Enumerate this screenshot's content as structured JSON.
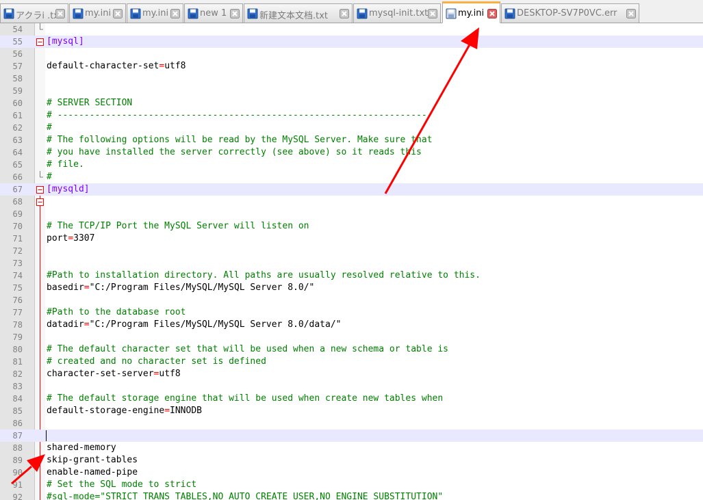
{
  "tabs": [
    {
      "label": "アクラi .txt",
      "icon": "saved-file-icon",
      "active": false
    },
    {
      "label": "my.ini",
      "icon": "saved-file-icon",
      "active": false
    },
    {
      "label": "my.ini",
      "icon": "saved-file-icon",
      "active": false
    },
    {
      "label": "new 1",
      "icon": "saved-file-icon",
      "active": false
    },
    {
      "label": "新建文本文档.txt",
      "icon": "saved-file-icon",
      "active": false
    },
    {
      "label": "mysql-init.txt",
      "icon": "saved-file-icon",
      "active": false
    },
    {
      "label": "my.ini",
      "icon": "unsaved-file-icon",
      "active": true
    },
    {
      "label": "DESKTOP-SV7P0VC.err",
      "icon": "saved-file-icon",
      "active": false
    }
  ],
  "editor": {
    "highlighted_lines": [
      55,
      67,
      87
    ],
    "caret_line": 87,
    "lines": [
      {
        "n": "54",
        "type": "empty",
        "text": ""
      },
      {
        "n": "55",
        "type": "section",
        "text": "[mysql]"
      },
      {
        "n": "56",
        "type": "empty",
        "text": ""
      },
      {
        "n": "57",
        "type": "kv",
        "key": "default-character-set",
        "op": "=",
        "val": "utf8"
      },
      {
        "n": "58",
        "type": "empty",
        "text": ""
      },
      {
        "n": "59",
        "type": "empty",
        "text": ""
      },
      {
        "n": "60",
        "type": "comment",
        "text": "# SERVER SECTION"
      },
      {
        "n": "61",
        "type": "comment",
        "text": "# ----------------------------------------------------------------------"
      },
      {
        "n": "62",
        "type": "comment",
        "text": "#"
      },
      {
        "n": "63",
        "type": "comment",
        "text": "# The following options will be read by the MySQL Server. Make sure that"
      },
      {
        "n": "64",
        "type": "comment",
        "text": "# you have installed the server correctly (see above) so it reads this"
      },
      {
        "n": "65",
        "type": "comment",
        "text": "# file."
      },
      {
        "n": "66",
        "type": "comment",
        "text": "#"
      },
      {
        "n": "67",
        "type": "section",
        "text": "[mysqld]"
      },
      {
        "n": "68",
        "type": "empty",
        "text": ""
      },
      {
        "n": "69",
        "type": "empty",
        "text": ""
      },
      {
        "n": "70",
        "type": "comment",
        "text": "# The TCP/IP Port the MySQL Server will listen on"
      },
      {
        "n": "71",
        "type": "kv",
        "key": "port",
        "op": "=",
        "val": "3307"
      },
      {
        "n": "72",
        "type": "empty",
        "text": ""
      },
      {
        "n": "73",
        "type": "empty",
        "text": ""
      },
      {
        "n": "74",
        "type": "comment",
        "text": "#Path to installation directory. All paths are usually resolved relative to this."
      },
      {
        "n": "75",
        "type": "kv",
        "key": "basedir",
        "op": "=",
        "val": "\"C:/Program Files/MySQL/MySQL Server 8.0/\""
      },
      {
        "n": "76",
        "type": "empty",
        "text": ""
      },
      {
        "n": "77",
        "type": "comment",
        "text": "#Path to the database root"
      },
      {
        "n": "78",
        "type": "kv",
        "key": "datadir",
        "op": "=",
        "val": "\"C:/Program Files/MySQL/MySQL Server 8.0/data/\""
      },
      {
        "n": "79",
        "type": "empty",
        "text": ""
      },
      {
        "n": "80",
        "type": "comment",
        "text": "# The default character set that will be used when a new schema or table is"
      },
      {
        "n": "81",
        "type": "comment",
        "text": "# created and no character set is defined"
      },
      {
        "n": "82",
        "type": "kv",
        "key": "character-set-server",
        "op": "=",
        "val": "utf8"
      },
      {
        "n": "83",
        "type": "empty",
        "text": ""
      },
      {
        "n": "84",
        "type": "comment",
        "text": "# The default storage engine that will be used when create new tables when"
      },
      {
        "n": "85",
        "type": "kv",
        "key": "default-storage-engine",
        "op": "=",
        "val": "INNODB"
      },
      {
        "n": "86",
        "type": "empty",
        "text": ""
      },
      {
        "n": "87",
        "type": "empty",
        "text": ""
      },
      {
        "n": "88",
        "type": "plain",
        "text": "shared-memory"
      },
      {
        "n": "89",
        "type": "plain",
        "text": "skip-grant-tables"
      },
      {
        "n": "90",
        "type": "plain",
        "text": "enable-named-pipe"
      },
      {
        "n": "91",
        "type": "comment",
        "text": "# Set the SQL mode to strict"
      },
      {
        "n": "92",
        "type": "comment",
        "text": "#sql-mode=\"STRICT_TRANS_TABLES,NO_AUTO_CREATE_USER,NO_ENGINE_SUBSTITUTION\""
      }
    ]
  },
  "colors": {
    "comment": "#008000",
    "section": "#8000ff",
    "operator": "#ff0000",
    "annotation_arrow": "#ff0000",
    "active_tab_accent": "#fbaf3f"
  }
}
